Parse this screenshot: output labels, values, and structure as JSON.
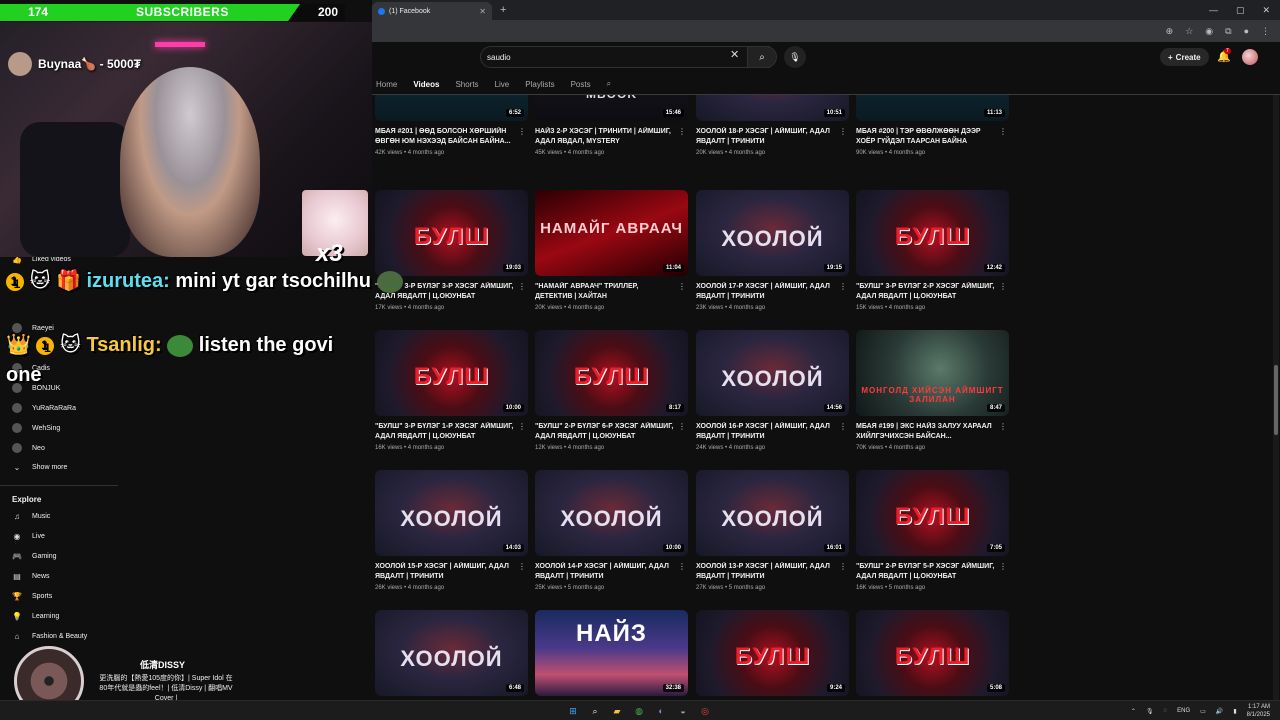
{
  "stream": {
    "sub_goal_current": "174",
    "sub_goal_label": "SUBSCRIBERS",
    "sub_goal_target": "200",
    "sub_goal_progress": 0.87,
    "donation_text": "Buynaa🍗 - 5000₮",
    "cat_multiplier": "x3",
    "chat": [
      {
        "user": "izurutea:",
        "text": " mini yt gar tsochilhu"
      },
      {
        "user": "Tsanlig:",
        "text": " listen the govi one"
      }
    ],
    "chat_badge": "1",
    "now_playing_title": "低清DISSY",
    "now_playing_sub": "更洗腦的【熱愛105度的你】| Super Idol 在80年代就是蟲的feel！| 低清Dissy | 翻唱MV Cover |"
  },
  "browser": {
    "tab_title": "(1) Facebook",
    "new_tab": "+"
  },
  "youtube": {
    "search_value": "saudio",
    "create_label": "Create",
    "notification_count": "7",
    "channel_tabs": [
      "Home",
      "Videos",
      "Shorts",
      "Live",
      "Playlists",
      "Posts"
    ],
    "active_tab": "Videos",
    "sidebar": {
      "liked": "Liked videos",
      "subs": [
        "Raeyei",
        "Cadis",
        "BONJUK",
        "YuRaRaRaRa",
        "WehSing",
        "Neo"
      ],
      "show_more": "Show more",
      "explore_heading": "Explore",
      "explore": [
        "Music",
        "Live",
        "Gaming",
        "News",
        "Sports",
        "Learning",
        "Fashion & Beauty"
      ]
    },
    "videos": [
      {
        "thumb": "mbaya",
        "thumb_text": "",
        "duration": "6:52",
        "title": "МБАЯ #201 | ӨӨД БОЛСОН ХӨРШИЙН ӨВГӨН ЮМ НЭХЭЭД БАЙСАН БАЙНА...",
        "meta": "42K views • 4 months ago"
      },
      {
        "thumb": "naiz2",
        "thumb_text": "MBOOK",
        "duration": "15:46",
        "title": "НАЙЗ 2-Р ХЭСЭГ | ТРИНИТИ | АЙМШИГ, АДАЛ ЯВДАЛ, MYSTERY",
        "meta": "45K views • 4 months ago"
      },
      {
        "thumb": "hoolo",
        "thumb_text": "ХООЛОЙ",
        "duration": "10:51",
        "title": "ХООЛОЙ 18-Р ХЭСЭГ | АЙМШИГ, АДАЛ ЯВДАЛТ | ТРИНИТИ",
        "meta": "20K views • 4 months ago"
      },
      {
        "thumb": "mbaya",
        "thumb_text": "",
        "duration": "11:13",
        "title": "МБАЯ #200 | ТЭР ӨВӨЛЖӨӨН ДЭЭР ХОЁР ГҮЙДЭЛ ТААРСАН БАЙНА ГЭСЭН...",
        "meta": "90K views • 4 months ago"
      },
      {
        "thumb": "bulsh",
        "thumb_text": "БУЛШ",
        "duration": "19:03",
        "title": "\"БУЛШ\" 3-Р БҮЛЭГ 3-Р ХЭСЭГ АЙМШИГ, АДАЛ ЯВДАЛТ | Ц.ОЮУНБАТ",
        "meta": "17K views • 4 months ago"
      },
      {
        "thumb": "namaig",
        "thumb_text": "НАМАЙГ АВРААЧ",
        "duration": "11:04",
        "title": "\"НАМАЙГ АВРААЧ\" ТРИЛЛЕР, ДЕТЕКТИВ | ХАЙТАН",
        "meta": "20K views • 4 months ago"
      },
      {
        "thumb": "hoolo",
        "thumb_text": "ХООЛОЙ",
        "duration": "19:15",
        "title": "ХООЛОЙ 17-Р ХЭСЭГ | АЙМШИГ, АДАЛ ЯВДАЛТ | ТРИНИТИ",
        "meta": "23K views • 4 months ago"
      },
      {
        "thumb": "bulsh",
        "thumb_text": "БУЛШ",
        "duration": "12:42",
        "title": "\"БУЛШ\" 3-Р БҮЛЭГ 2-Р ХЭСЭГ АЙМШИГ, АДАЛ ЯВДАЛТ | Ц.ОЮУНБАТ",
        "meta": "15K views • 4 months ago"
      },
      {
        "thumb": "bulsh",
        "thumb_text": "БУЛШ",
        "duration": "10:00",
        "title": "\"БУЛШ\" 3-Р БҮЛЭГ 1-Р ХЭСЭГ АЙМШИГ, АДАЛ ЯВДАЛТ | Ц.ОЮУНБАТ",
        "meta": "16K views • 4 months ago"
      },
      {
        "thumb": "bulsh",
        "thumb_text": "БУЛШ",
        "duration": "8:17",
        "title": "\"БУЛШ\" 2-Р БҮЛЭГ 6-Р ХЭСЭГ АЙМШИГ, АДАЛ ЯВДАЛТ | Ц.ОЮУНБАТ",
        "meta": "12K views • 4 months ago"
      },
      {
        "thumb": "hoolo",
        "thumb_text": "ХООЛОЙ",
        "duration": "14:56",
        "title": "ХООЛОЙ 16-Р ХЭСЭГ | АЙМШИГ, АДАЛ ЯВДАЛТ | ТРИНИТИ",
        "meta": "24K views • 4 months ago"
      },
      {
        "thumb": "mbaya2",
        "thumb_text": "МОНГОЛД ХИЙСЭН АЙМШИГТ ЗАЛИЛАН",
        "duration": "8:47",
        "title": "МБАЯ #199 | ЭКС НАЙЗ ЗАЛУУ ХАРААЛ ХИЙЛГЭЧИХСЭН БАЙСАН...",
        "meta": "70K views • 4 months ago"
      },
      {
        "thumb": "hoolo",
        "thumb_text": "ХООЛОЙ",
        "duration": "14:03",
        "title": "ХООЛОЙ 15-Р ХЭСЭГ | АЙМШИГ, АДАЛ ЯВДАЛТ | ТРИНИТИ",
        "meta": "26K views • 4 months ago"
      },
      {
        "thumb": "hoolo",
        "thumb_text": "ХООЛОЙ",
        "duration": "10:00",
        "title": "ХООЛОЙ 14-Р ХЭСЭГ | АЙМШИГ, АДАЛ ЯВДАЛТ | ТРИНИТИ",
        "meta": "25K views • 5 months ago"
      },
      {
        "thumb": "hoolo",
        "thumb_text": "ХООЛОЙ",
        "duration": "16:01",
        "title": "ХООЛОЙ 13-Р ХЭСЭГ | АЙМШИГ, АДАЛ ЯВДАЛТ | ТРИНИТИ",
        "meta": "27K views • 5 months ago"
      },
      {
        "thumb": "bulsh",
        "thumb_text": "БУЛШ",
        "duration": "7:05",
        "title": "\"БУЛШ\" 2-Р БҮЛЭГ 5-Р ХЭСЭГ АЙМШИГ, АДАЛ ЯВДАЛТ | Ц.ОЮУНБАТ",
        "meta": "16K views • 5 months ago"
      },
      {
        "thumb": "hoolo",
        "thumb_text": "ХООЛОЙ",
        "duration": "6:48",
        "title": "",
        "meta": ""
      },
      {
        "thumb": "naiz",
        "thumb_text": "НАЙЗ",
        "duration": "32:38",
        "title": "",
        "meta": ""
      },
      {
        "thumb": "bulsh",
        "thumb_text": "БУЛШ",
        "duration": "9:24",
        "title": "",
        "meta": ""
      },
      {
        "thumb": "bulsh",
        "thumb_text": "БУЛШ",
        "duration": "5:08",
        "title": "",
        "meta": ""
      }
    ]
  },
  "taskbar": {
    "lang": "ENG",
    "time": "1:17 AM",
    "date": "8/1/2025"
  },
  "colors": {
    "sub_bar_fill": "#22d022",
    "accent_red": "#cc0000",
    "bg": "#0f0f0f"
  }
}
